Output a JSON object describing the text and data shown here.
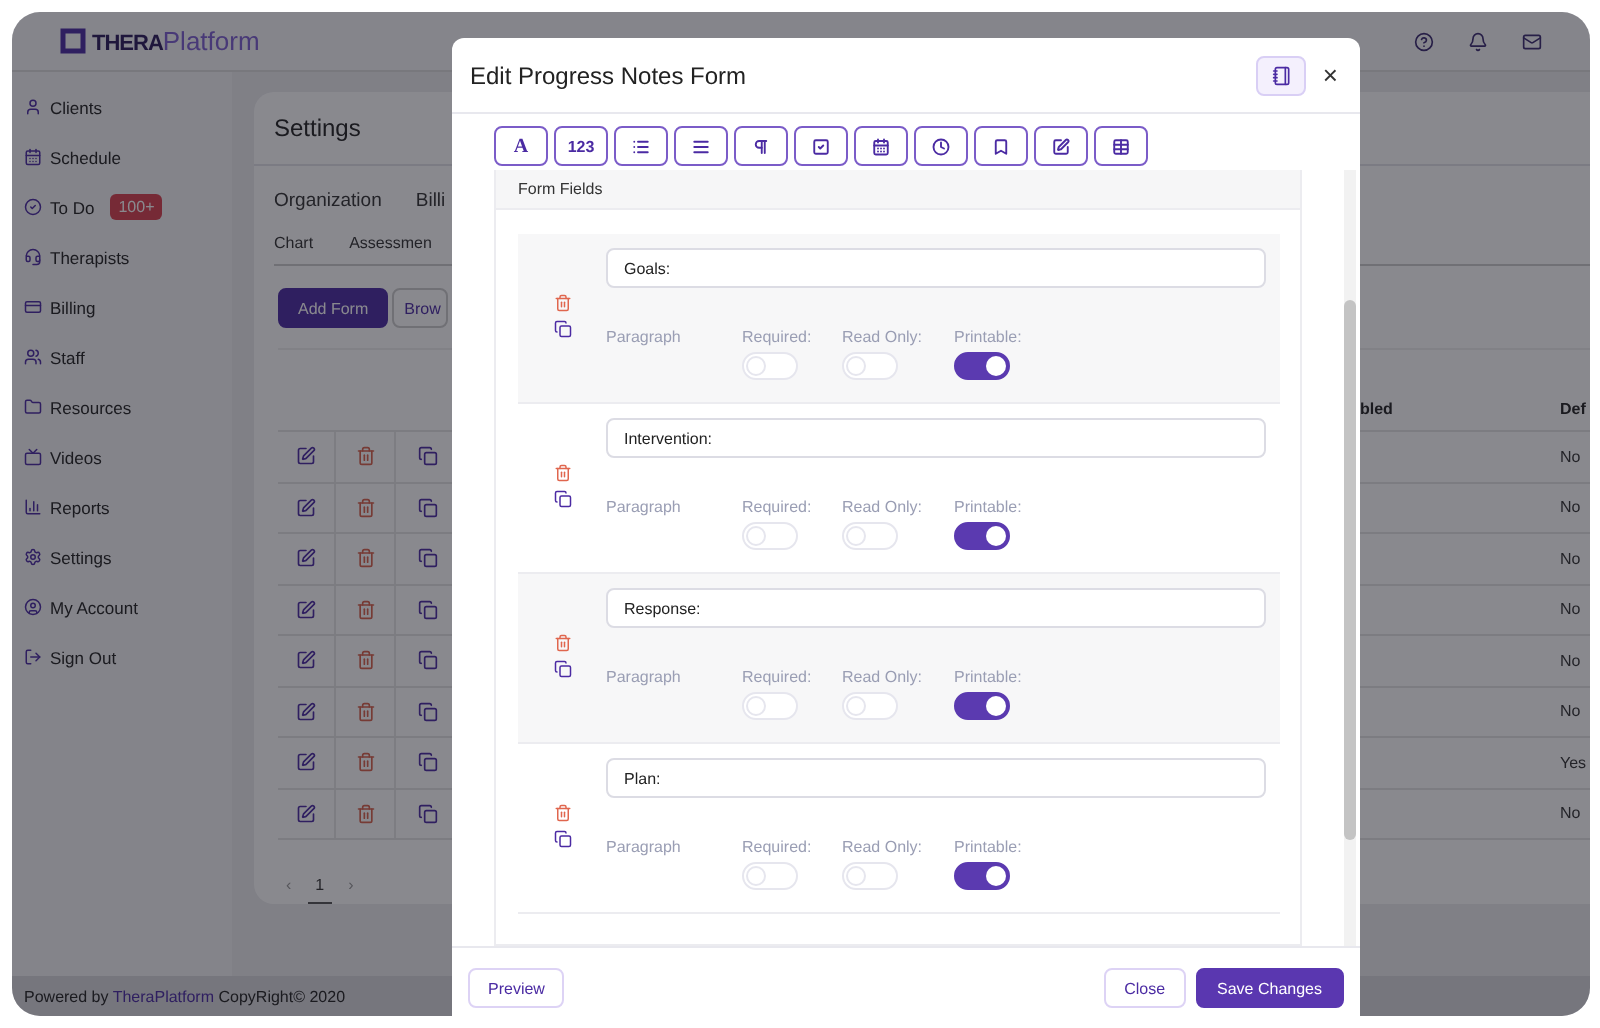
{
  "topbar": {
    "logo": "**THERA**Platform"
  },
  "sidebar": {
    "items": [
      {
        "label": "Clients"
      },
      {
        "label": "Schedule"
      },
      {
        "label": "To Do",
        "badge": "100+"
      },
      {
        "label": "Therapists"
      },
      {
        "label": "Billing"
      },
      {
        "label": "Staff"
      },
      {
        "label": "Resources"
      },
      {
        "label": "Videos"
      },
      {
        "label": "Reports"
      },
      {
        "label": "Settings"
      },
      {
        "label": "My Account"
      },
      {
        "label": "Sign Out"
      }
    ]
  },
  "page": {
    "title": "Settings",
    "tabs": [
      {
        "label": "Organization"
      },
      {
        "label": "Billi"
      }
    ],
    "subtabs": [
      {
        "label": "Chart"
      },
      {
        "label": "Assessmen"
      }
    ],
    "buttons": [
      {
        "label": "Add Form",
        "kind": "primary"
      },
      {
        "label": "Brow",
        "kind": "outline"
      }
    ],
    "table": {
      "columns": [
        "bled",
        "Def"
      ],
      "rows": [
        {
          "column_2": "No"
        },
        {
          "column_2": "No"
        },
        {
          "column_2": "No"
        },
        {
          "column_2": "No"
        },
        {
          "column_2": "No"
        },
        {
          "column_2": "No"
        },
        {
          "column_2": "Yes"
        },
        {
          "column_2": "No"
        }
      ]
    },
    "pagination": {
      "prev": "‹",
      "page": "1",
      "next": "›"
    }
  },
  "footer": {
    "before": "Powered by",
    "brand": "TheraPlatform",
    "after": "CopyRight© 2020"
  },
  "modal": {
    "title": "Edit Progress Notes Form",
    "close": "×",
    "toolbar": [
      {
        "kind": "letter",
        "label": "A"
      },
      {
        "kind": "number",
        "label": "123"
      },
      {
        "kind": "list"
      },
      {
        "kind": "lines"
      },
      {
        "kind": "paragraph"
      },
      {
        "kind": "checkbox"
      },
      {
        "kind": "calendar"
      },
      {
        "kind": "clock"
      },
      {
        "kind": "bookmark"
      },
      {
        "kind": "edit"
      },
      {
        "kind": "table"
      }
    ],
    "section_title": "Form Fields",
    "fields": [
      {
        "value": "Goals:",
        "type": "Paragraph",
        "toggles": [
          {
            "label": "Required:",
            "on": false
          },
          {
            "label": "Read Only:",
            "on": false
          },
          {
            "label": "Printable:",
            "on": true
          }
        ]
      },
      {
        "value": "Intervention:",
        "type": "Paragraph",
        "toggles": [
          {
            "label": "Required:",
            "on": false
          },
          {
            "label": "Read Only:",
            "on": false
          },
          {
            "label": "Printable:",
            "on": true
          }
        ]
      },
      {
        "value": "Response:",
        "type": "Paragraph",
        "toggles": [
          {
            "label": "Required:",
            "on": false
          },
          {
            "label": "Read Only:",
            "on": false
          },
          {
            "label": "Printable:",
            "on": true
          }
        ]
      },
      {
        "value": "Plan:",
        "type": "Paragraph",
        "toggles": [
          {
            "label": "Required:",
            "on": false
          },
          {
            "label": "Read Only:",
            "on": false
          },
          {
            "label": "Printable:",
            "on": true
          }
        ]
      }
    ],
    "buttons": {
      "preview": "Preview",
      "close": "Close",
      "save": "Save Changes"
    }
  }
}
